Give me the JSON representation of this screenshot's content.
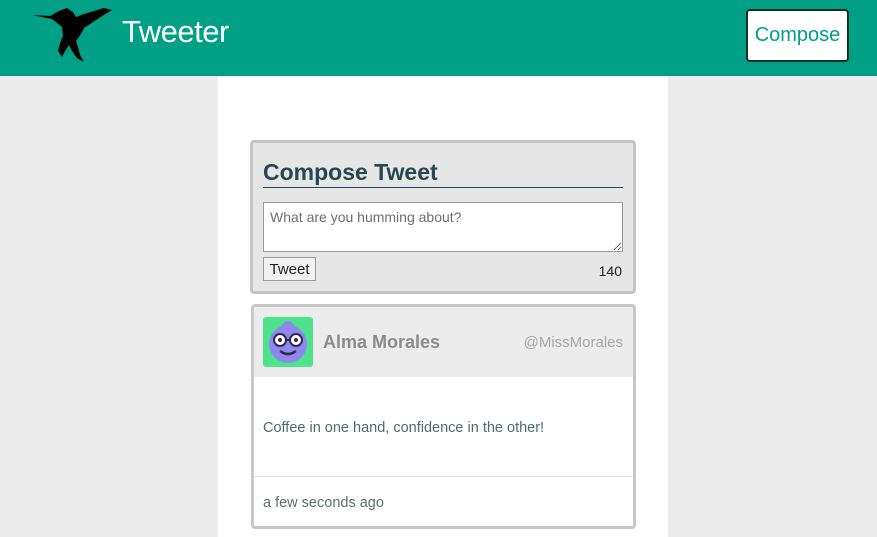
{
  "header": {
    "brand": "Tweeter",
    "logo_icon": "hummingbird-icon",
    "compose_label": "Compose",
    "accent_color": "#00a087"
  },
  "compose": {
    "title": "Compose Tweet",
    "placeholder": "What are you humming about?",
    "tweet_button": "Tweet",
    "counter": "140"
  },
  "tweets": [
    {
      "avatar_icon": "robot-avatar-icon",
      "name": "Alma Morales",
      "handle": "@MissMorales",
      "text": "Coffee in one hand, confidence in the other!",
      "time": "a few seconds ago"
    }
  ]
}
